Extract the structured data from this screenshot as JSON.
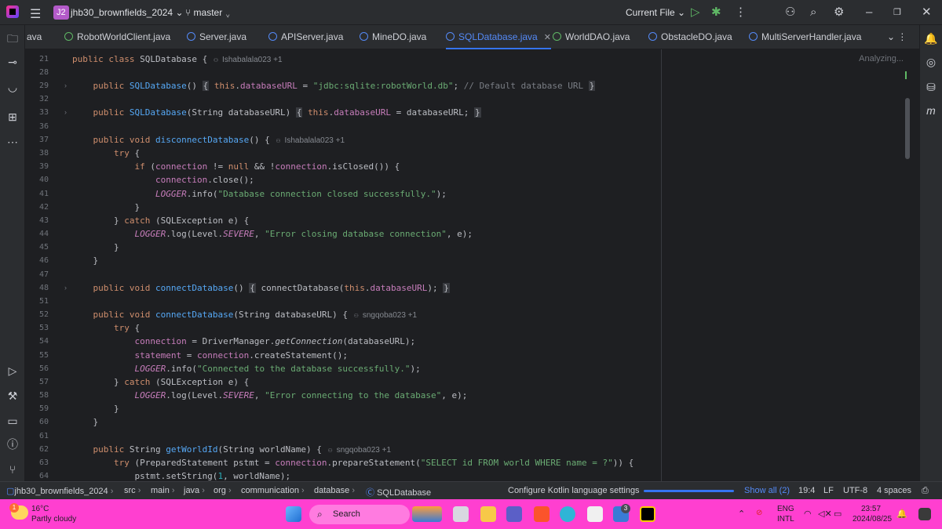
{
  "titlebar": {
    "project_badge": "J2",
    "project_name": "jhb30_brownfields_2024",
    "branch": "master",
    "run_config": "Current File"
  },
  "tabs": [
    {
      "label": "ava",
      "active": false
    },
    {
      "label": "RobotWorldClient.java",
      "active": false
    },
    {
      "label": "Server.java",
      "active": false
    },
    {
      "label": "APIServer.java",
      "active": false
    },
    {
      "label": "MineDO.java",
      "active": false
    },
    {
      "label": "SQLDatabase.java",
      "active": true
    },
    {
      "label": "WorldDAO.java",
      "active": false
    },
    {
      "label": "ObstacleDO.java",
      "active": false
    },
    {
      "label": "MultiServerHandler.java",
      "active": false
    }
  ],
  "editor": {
    "analyzing": "Analyzing...",
    "hints": {
      "h21": "Ishabalala023 +1",
      "h37": "Ishabalala023 +1",
      "h52": "sngqoba023 +1",
      "h62": "sngqoba023 +1"
    },
    "line_numbers": [
      "21",
      "28",
      "29",
      "32",
      "33",
      "36",
      "37",
      "38",
      "39",
      "40",
      "41",
      "42",
      "43",
      "44",
      "45",
      "46",
      "47",
      "48",
      "51",
      "52",
      "53",
      "54",
      "55",
      "56",
      "57",
      "58",
      "59",
      "60",
      "61",
      "62",
      "63",
      "64"
    ]
  },
  "statusbar": {
    "breadcrumb": [
      "jhb30_brownfields_2024",
      "src",
      "main",
      "java",
      "org",
      "communication",
      "database",
      "SQLDatabase"
    ],
    "notice": "Configure Kotlin language settings",
    "show_all": "Show all (2)",
    "position": "19:4",
    "line_sep": "LF",
    "encoding": "UTF-8",
    "indent": "4 spaces"
  },
  "taskbar": {
    "weather_temp": "16°C",
    "weather_desc": "Partly cloudy",
    "weather_badge": "1",
    "search_placeholder": "Search",
    "badge_count": "3",
    "lang": "ENG",
    "lang2": "INTL",
    "time": "23:57",
    "date": "2024/08/25"
  }
}
